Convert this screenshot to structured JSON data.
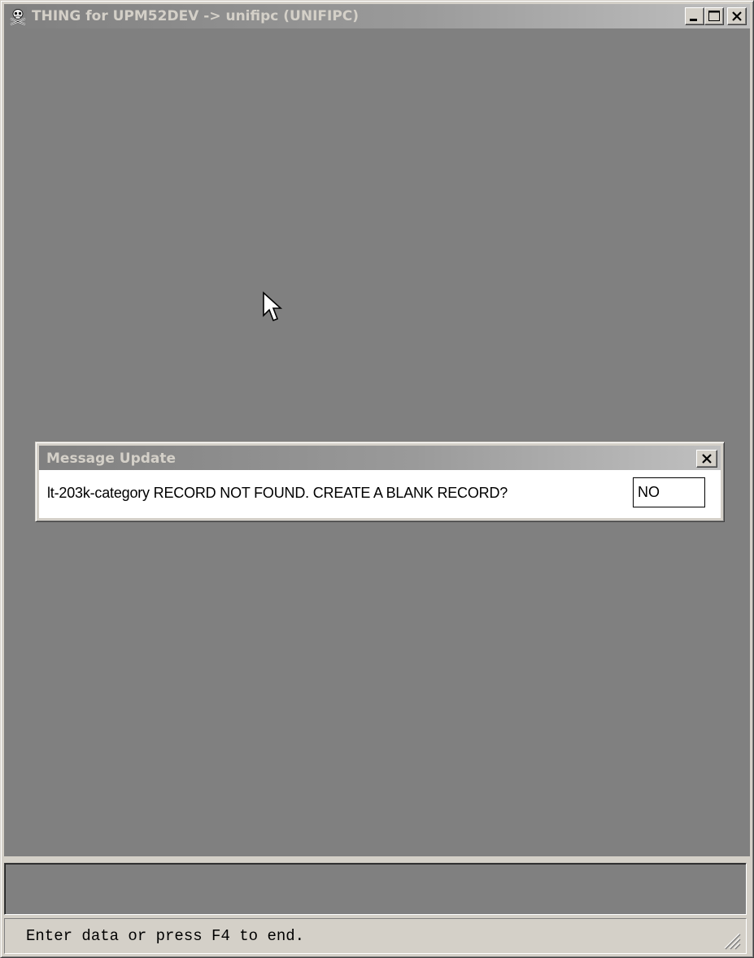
{
  "window": {
    "title": "THING for UPM52DEV -> unifipc (UNIFIPC)",
    "icon": "skull-crossbones-icon",
    "controls": {
      "minimize": "minimize-icon",
      "maximize": "maximize-icon",
      "close": "close-icon"
    }
  },
  "dialog": {
    "title": "Message Update",
    "message": "lt-203k-category RECORD NOT FOUND. CREATE A BLANK RECORD?",
    "input_value": "NO",
    "close_icon": "close-icon"
  },
  "status_bar": {
    "text": "Enter data or press F4 to end."
  },
  "colors": {
    "workspace": "#808080",
    "chrome": "#d4d0c8",
    "title_inactive_start": "#808080",
    "title_inactive_end": "#c0c0c0",
    "title_text": "#d4d0c8"
  }
}
